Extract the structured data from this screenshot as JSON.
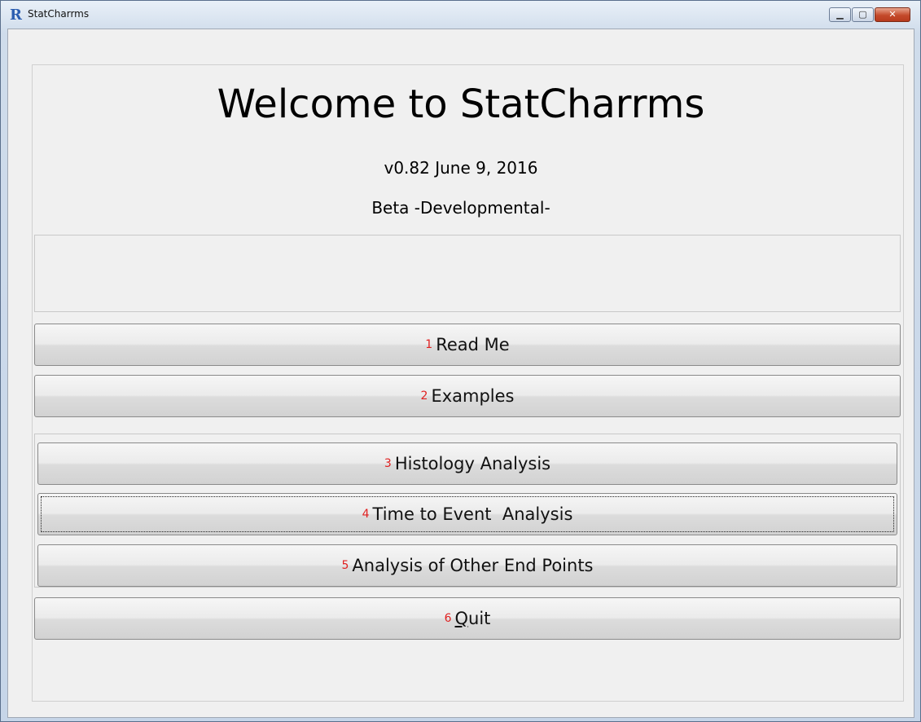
{
  "window": {
    "title": "StatCharrms",
    "app_icon_glyph": "R",
    "controls": {
      "minimize_glyph": "▁",
      "maximize_glyph": "▢",
      "close_glyph": "✕"
    }
  },
  "header": {
    "title": "Welcome to StatCharrms",
    "version": "v0.82 June 9, 2016",
    "status": "Beta -Developmental-"
  },
  "buttons": {
    "read_me": {
      "num": "1",
      "label": "Read Me"
    },
    "examples": {
      "num": "2",
      "label": "Examples"
    },
    "histology": {
      "num": "3",
      "label": "Histology Analysis"
    },
    "time_to_event": {
      "num": "4",
      "label": "Time to Event  Analysis"
    },
    "other_endpoints": {
      "num": "5",
      "label": "Analysis of Other End Points"
    },
    "quit": {
      "num": "6",
      "label_underlined": "Q",
      "label_rest": "uit"
    }
  },
  "colors": {
    "number_accent": "#e02020",
    "close_button": "#c44a2b"
  }
}
